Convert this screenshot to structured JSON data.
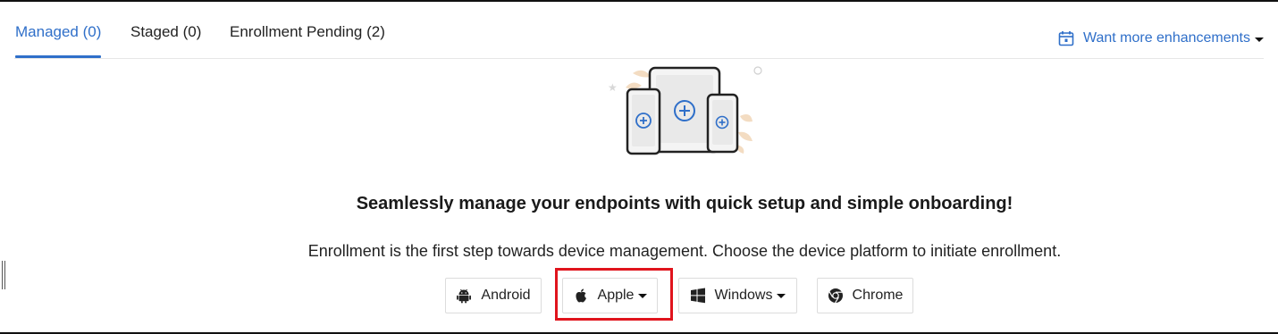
{
  "tabs": [
    {
      "label": "Managed (0)",
      "active": true
    },
    {
      "label": "Staged (0)",
      "active": false
    },
    {
      "label": "Enrollment Pending (2)",
      "active": false
    }
  ],
  "enhancements_link": {
    "label": "Want more enhancements",
    "icon": "calendar-icon"
  },
  "empty_state": {
    "illustration": "devices-add-illustration",
    "headline": "Seamlessly manage your endpoints with quick setup and simple onboarding!",
    "description": "Enrollment is the first step towards device management. Choose the device platform to initiate enrollment."
  },
  "platforms": [
    {
      "label": "Android",
      "icon": "android-icon",
      "dropdown": false
    },
    {
      "label": "Apple",
      "icon": "apple-icon",
      "dropdown": true,
      "highlighted": true
    },
    {
      "label": "Windows",
      "icon": "windows-icon",
      "dropdown": true
    },
    {
      "label": "Chrome",
      "icon": "chrome-icon",
      "dropdown": false
    }
  ],
  "colors": {
    "accent": "#2f6fc9",
    "highlight": "#e0141d",
    "text": "#222222"
  }
}
